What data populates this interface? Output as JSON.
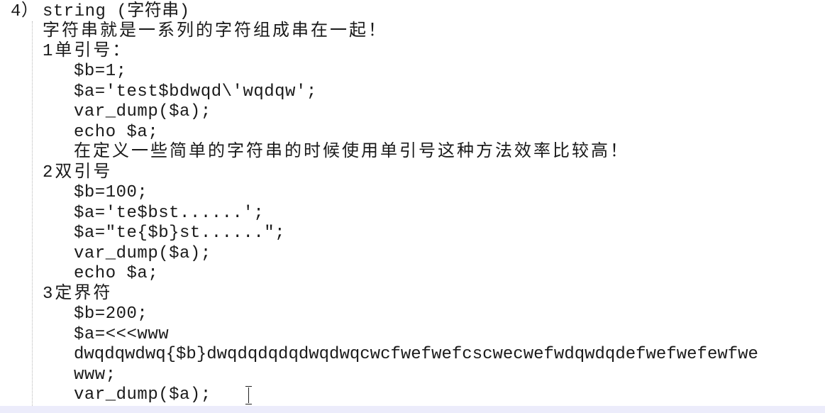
{
  "lines": [
    "4）",
    "string (字符串)",
    "字符串就是一系列的字符组成串在一起！",
    "1单引号：",
    "$b=1;",
    "$a='test$bdwqd\\'wqdqw';",
    "var_dump($a);",
    "echo $a;",
    "在定义一些简单的字符串的时候使用单引号这种方法效率比较高！",
    "2双引号",
    "$b=100;",
    "$a='te$bst......';",
    "$a=\"te{$b}st......\";",
    "var_dump($a);",
    "echo $a;",
    "3定界符",
    "$b=200;",
    "$a=<<<www",
    "dwqdqwdwq{$b}dwqdqdqdqdwqdwqcwcfwefwefcscwecwefwdqwdqdefwefwefewfwe",
    "www;",
    "var_dump($a);"
  ]
}
